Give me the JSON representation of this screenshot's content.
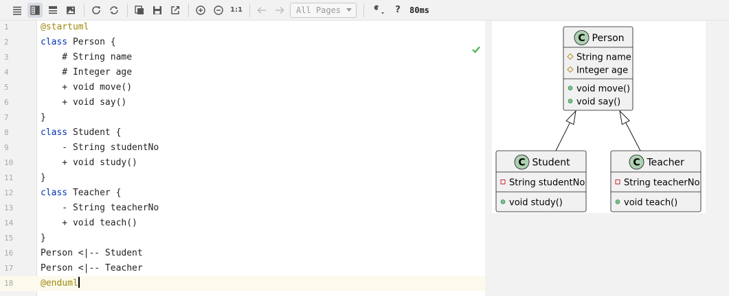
{
  "toolbar": {
    "buttons": [
      {
        "name": "editor-only-icon",
        "active": false
      },
      {
        "name": "split-view-icon",
        "active": true
      },
      {
        "name": "preview-only-icon",
        "active": false
      },
      {
        "name": "image-icon",
        "active": false
      }
    ],
    "pages_select": "All Pages",
    "help_label": "?",
    "render_time": "80ms"
  },
  "editor": {
    "lines": [
      {
        "no": "1",
        "tokens": [
          {
            "t": "@startuml",
            "c": "dir"
          }
        ]
      },
      {
        "no": "2",
        "tokens": [
          {
            "t": "class",
            "c": "kw"
          },
          {
            "t": " Person {",
            "c": ""
          }
        ]
      },
      {
        "no": "3",
        "tokens": [
          {
            "t": "    # String name",
            "c": ""
          }
        ]
      },
      {
        "no": "4",
        "tokens": [
          {
            "t": "    # Integer age",
            "c": ""
          }
        ]
      },
      {
        "no": "5",
        "tokens": [
          {
            "t": "    + void move()",
            "c": ""
          }
        ]
      },
      {
        "no": "6",
        "tokens": [
          {
            "t": "    + void say()",
            "c": ""
          }
        ]
      },
      {
        "no": "7",
        "tokens": [
          {
            "t": "}",
            "c": ""
          }
        ]
      },
      {
        "no": "8",
        "tokens": [
          {
            "t": "class",
            "c": "kw"
          },
          {
            "t": " Student {",
            "c": ""
          }
        ]
      },
      {
        "no": "9",
        "tokens": [
          {
            "t": "    - String studentNo",
            "c": ""
          }
        ]
      },
      {
        "no": "10",
        "tokens": [
          {
            "t": "    + void study()",
            "c": ""
          }
        ]
      },
      {
        "no": "11",
        "tokens": [
          {
            "t": "}",
            "c": ""
          }
        ]
      },
      {
        "no": "12",
        "tokens": [
          {
            "t": "class",
            "c": "kw"
          },
          {
            "t": " Teacher {",
            "c": ""
          }
        ]
      },
      {
        "no": "13",
        "tokens": [
          {
            "t": "    - String teacherNo",
            "c": ""
          }
        ]
      },
      {
        "no": "14",
        "tokens": [
          {
            "t": "    + void teach()",
            "c": ""
          }
        ]
      },
      {
        "no": "15",
        "tokens": [
          {
            "t": "}",
            "c": ""
          }
        ]
      },
      {
        "no": "16",
        "tokens": [
          {
            "t": "Person <|-- Student",
            "c": ""
          }
        ]
      },
      {
        "no": "17",
        "tokens": [
          {
            "t": "Person <|-- Teacher",
            "c": ""
          }
        ]
      },
      {
        "no": "18",
        "tokens": [
          {
            "t": "@enduml",
            "c": "dir"
          }
        ],
        "current": true
      }
    ]
  },
  "diagram": {
    "classes": [
      {
        "id": "person",
        "stereo": "C",
        "name": "Person",
        "fields": [
          {
            "vis": "protected",
            "text": "String name"
          },
          {
            "vis": "protected",
            "text": "Integer age"
          }
        ],
        "methods": [
          {
            "vis": "public",
            "text": "void move()"
          },
          {
            "vis": "public",
            "text": "void say()"
          }
        ]
      },
      {
        "id": "student",
        "stereo": "C",
        "name": "Student",
        "fields": [
          {
            "vis": "private",
            "text": "String studentNo"
          }
        ],
        "methods": [
          {
            "vis": "public",
            "text": "void study()"
          }
        ]
      },
      {
        "id": "teacher",
        "stereo": "C",
        "name": "Teacher",
        "fields": [
          {
            "vis": "private",
            "text": "String teacherNo"
          }
        ],
        "methods": [
          {
            "vis": "public",
            "text": "void teach()"
          }
        ]
      }
    ],
    "relations": [
      {
        "from": "student",
        "to": "person",
        "type": "extends"
      },
      {
        "from": "teacher",
        "to": "person",
        "type": "extends"
      }
    ]
  },
  "colors": {
    "class_fill": "#f1f1f1",
    "class_border": "#181818",
    "stereo_circle": "#add1b2",
    "public_dot": "#84be84",
    "private_square": "#c82930",
    "protected_diamond": "#b38d22",
    "check": "#4caf50"
  }
}
